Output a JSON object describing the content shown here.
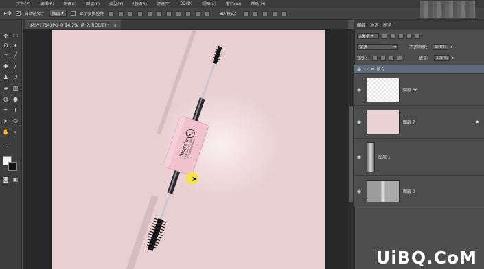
{
  "menubar": {
    "items": [
      "文件(F)",
      "编辑(E)",
      "图像(I)",
      "图层(L)",
      "类型(Y)",
      "选择(S)",
      "滤镜(T)",
      "3D(D)",
      "视图(V)",
      "窗口(W)",
      "帮助(H)"
    ]
  },
  "options": {
    "auto_select_label": "自动选择：",
    "auto_select_value": "图层",
    "show_transform_label": "显示变换控件",
    "mode_3d_label": "3D 模式："
  },
  "document": {
    "tab_title": "IMSY1784.JPG @ 16.7% (组 7, RGB/8) *"
  },
  "product": {
    "brand": "Mogeline",
    "line1": "CURLING EYE SERUM",
    "line2": "COVER DEEPLASH"
  },
  "layers_panel": {
    "tabs": [
      "图层",
      "通道",
      "路径"
    ],
    "filter_label": "ρ类型",
    "blend_mode": "穿透",
    "opacity_label": "不透明度：",
    "opacity_value": "100%",
    "lock_label": "锁定：",
    "fill_label": "填充：",
    "fill_value": "100%",
    "layers": [
      {
        "name": "组 7",
        "type": "group",
        "visible": true
      },
      {
        "name": "图层 36",
        "type": "transparent",
        "visible": true
      },
      {
        "name": "图层 7",
        "type": "pink",
        "visible": true,
        "locked": true
      },
      {
        "name": "图层 1",
        "type": "mascara",
        "visible": true
      },
      {
        "name": "图层 0",
        "type": "photo",
        "visible": true
      }
    ]
  },
  "watermark": "UiBQ.CoM",
  "colors": {
    "canvas": "#ecd2d5",
    "accent": "#f3e34a",
    "selected_group": "#5f6b7b"
  }
}
